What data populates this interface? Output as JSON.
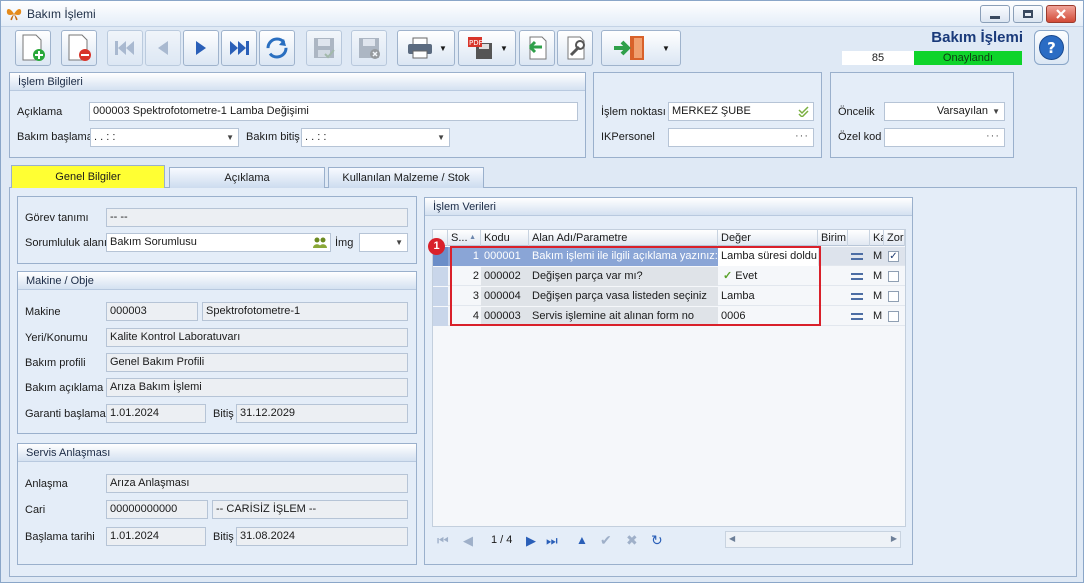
{
  "window": {
    "title": "Bakım İşlemi"
  },
  "header": {
    "form_title": "Bakım İşlemi",
    "count": "85",
    "status": "Onaylandı"
  },
  "toolbar": {
    "icons": [
      "new-doc-icon",
      "delete-doc-icon",
      "first-icon",
      "prev-icon",
      "next-icon",
      "last-icon",
      "refresh-icon",
      "save-icon",
      "save-close-icon",
      "print-icon",
      "pdf-save-icon",
      "import-icon",
      "tools-icon",
      "exit-icon",
      "help-icon"
    ]
  },
  "islem_bilgileri": {
    "title": "İşlem Bilgileri",
    "aciklama_label": "Açıklama",
    "aciklama_value": "000003 Spektrofotometre-1 Lamba Değişimi",
    "bakim_baslama_label": "Bakım başlama",
    "bakim_baslama_value": " .  .     :  :",
    "bakim_bitis_label": "Bakım bitiş",
    "bakim_bitis_value": " .  .     :  :"
  },
  "islem_noktasi": {
    "label": "İşlem noktası",
    "value": "MERKEZ ŞUBE",
    "ik_label": "IKPersonel",
    "ik_value": ""
  },
  "oncelik": {
    "label": "Öncelik",
    "value": "Varsayılan",
    "ozel_kod_label": "Özel kod",
    "ozel_kod_value": ""
  },
  "tabs": [
    {
      "label": "Genel Bilgiler"
    },
    {
      "label": "Açıklama"
    },
    {
      "label": "Kullanılan Malzeme / Stok"
    }
  ],
  "genel": {
    "gorev_label": "Görev tanımı",
    "gorev_value": "-- --",
    "sorumluluk_label": "Sorumluluk alanı",
    "sorumluluk_value": "Bakım Sorumlusu",
    "img_label": "İmg",
    "img_value": ""
  },
  "makine": {
    "title": "Makine / Obje",
    "makine_label": "Makine",
    "makine_code": "000003",
    "makine_name": "Spektrofotometre-1",
    "yeri_label": "Yeri/Konumu",
    "yeri_value": "Kalite Kontrol Laboratuvarı",
    "profil_label": "Bakım profili",
    "profil_value": "Genel Bakım Profili",
    "aciklama_label": "Bakım açıklama",
    "aciklama_value": "Arıza Bakım İşlemi",
    "garanti_label": "Garanti başlama",
    "garanti_value": "1.01.2024",
    "bitis_label": "Bitiş",
    "bitis_value": "31.12.2029"
  },
  "servis": {
    "title": "Servis Anlaşması",
    "anlasma_label": "Anlaşma",
    "anlasma_value": "Arıza Anlaşması",
    "cari_label": "Cari",
    "cari_code": "00000000000",
    "cari_name": "-- CARİSİZ İŞLEM --",
    "baslama_label": "Başlama tarihi",
    "baslama_value": "1.01.2024",
    "bitis_label": "Bitiş",
    "bitis_value": "31.08.2024"
  },
  "islem_verileri": {
    "title": "İşlem Verileri",
    "columns": [
      "S...",
      "Kodu",
      "Alan Adı/Parametre",
      "Değer",
      "Birim",
      "",
      "Ka",
      "Zor"
    ],
    "rows": [
      {
        "sira": "1",
        "kodu": "000001",
        "alan": "Bakım işlemi ile ilgili açıklama yazınız:",
        "deger": "Lamba süresi doldu",
        "ka": "M",
        "zor": true
      },
      {
        "sira": "2",
        "kodu": "000002",
        "alan": "Değişen parça var mı?",
        "deger": "Evet",
        "ka": "M",
        "zor": false
      },
      {
        "sira": "3",
        "kodu": "000004",
        "alan": "Değişen parça vasa listeden seçiniz",
        "deger": "Lamba",
        "ka": "M",
        "zor": false
      },
      {
        "sira": "4",
        "kodu": "000003",
        "alan": "Servis işlemine ait alınan form no",
        "deger": "0006",
        "ka": "M",
        "zor": false
      }
    ],
    "pager": "1 / 4",
    "annotation": "1"
  },
  "colors": {
    "accent": "#1a3a7a",
    "status": "#0fd42a",
    "highlight": "#d9202a",
    "active_tab": "#ffff33"
  }
}
